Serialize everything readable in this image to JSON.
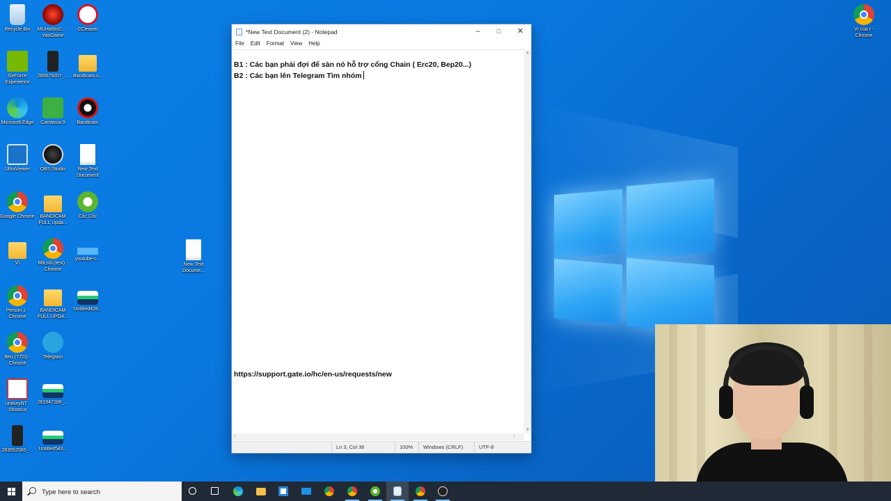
{
  "desktop": {
    "icons": [
      {
        "label": "Recycle Bin",
        "kind": "recycle"
      },
      {
        "label": "MUHaNoi2... - VaoGame",
        "kind": "game"
      },
      {
        "label": "CCleaner",
        "kind": "ccleaner"
      },
      {
        "label": "GeForce Experience",
        "kind": "nvidia"
      },
      {
        "label": "260679207_...",
        "kind": "phone"
      },
      {
        "label": "Bandicam.v...",
        "kind": "folder"
      },
      {
        "label": "Microsoft Edge",
        "kind": "edge"
      },
      {
        "label": "Camtasia 9",
        "kind": "camtasia"
      },
      {
        "label": "Bandicam",
        "kind": "bandicam"
      },
      {
        "label": "UltraViewer",
        "kind": "ultra"
      },
      {
        "label": "OBS Studio",
        "kind": "obs"
      },
      {
        "label": "New Text Document",
        "kind": "doc"
      },
      {
        "label": "Google Chrome",
        "kind": "chrome"
      },
      {
        "label": "BANDICAM FULL Upda...",
        "kind": "folder"
      },
      {
        "label": "Cốc Cốc",
        "kind": "coccoc"
      },
      {
        "label": "Ví",
        "kind": "folder"
      },
      {
        "label": "Mã sổi (test) - Chrome",
        "kind": "chrome"
      },
      {
        "label": "youtube-c...",
        "kind": "bar"
      },
      {
        "label": "Person 1 - Chrome",
        "kind": "chrome"
      },
      {
        "label": "BANDICAM FULL UPDA...",
        "kind": "folder"
      },
      {
        "label": "Untitled428...",
        "kind": "image"
      },
      {
        "label": "Beu (YTD) - Chrome",
        "kind": "chrome"
      },
      {
        "label": "Telegram",
        "kind": "telegram"
      },
      {
        "label": "UniKeyNT - Shortcut",
        "kind": "unikey"
      },
      {
        "label": "261947186_...",
        "kind": "image"
      },
      {
        "label": "263552565_...",
        "kind": "phone"
      },
      {
        "label": "Untitled543...",
        "kind": "image"
      },
      {
        "label": "New Text Docume...",
        "kind": "doc"
      },
      {
        "label": "Ví của t - Chrome",
        "kind": "chrome"
      }
    ]
  },
  "notepad": {
    "title": "*New Text Document (2) - Notepad",
    "menu": [
      "File",
      "Edit",
      "Format",
      "View",
      "Help"
    ],
    "lines": [
      "B1 : Các bạn phải đợi để sàn nó hỗ trợ cổng Chain ( Erc20, Bep20...)",
      "B2 : Các bạn lên Telegram Tìm nhóm",
      "https://support.gate.io/hc/en-us/requests/new"
    ],
    "status": {
      "position": "Ln 3, Col 36",
      "zoom": "100%",
      "line_endings": "Windows (CRLF)",
      "encoding": "UTF-8"
    }
  },
  "taskbar": {
    "search_placeholder": "Type here to search",
    "apps": [
      "cortana",
      "task-view",
      "edge",
      "file-explorer",
      "store",
      "mail",
      "chrome",
      "chrome-profile",
      "coccoc",
      "notepad",
      "chrome-profile-2",
      "obs"
    ]
  },
  "colors": {
    "desktop_blue": "#0a78e0",
    "taskbar": "#202a36",
    "accent": "#7cc4ff"
  }
}
